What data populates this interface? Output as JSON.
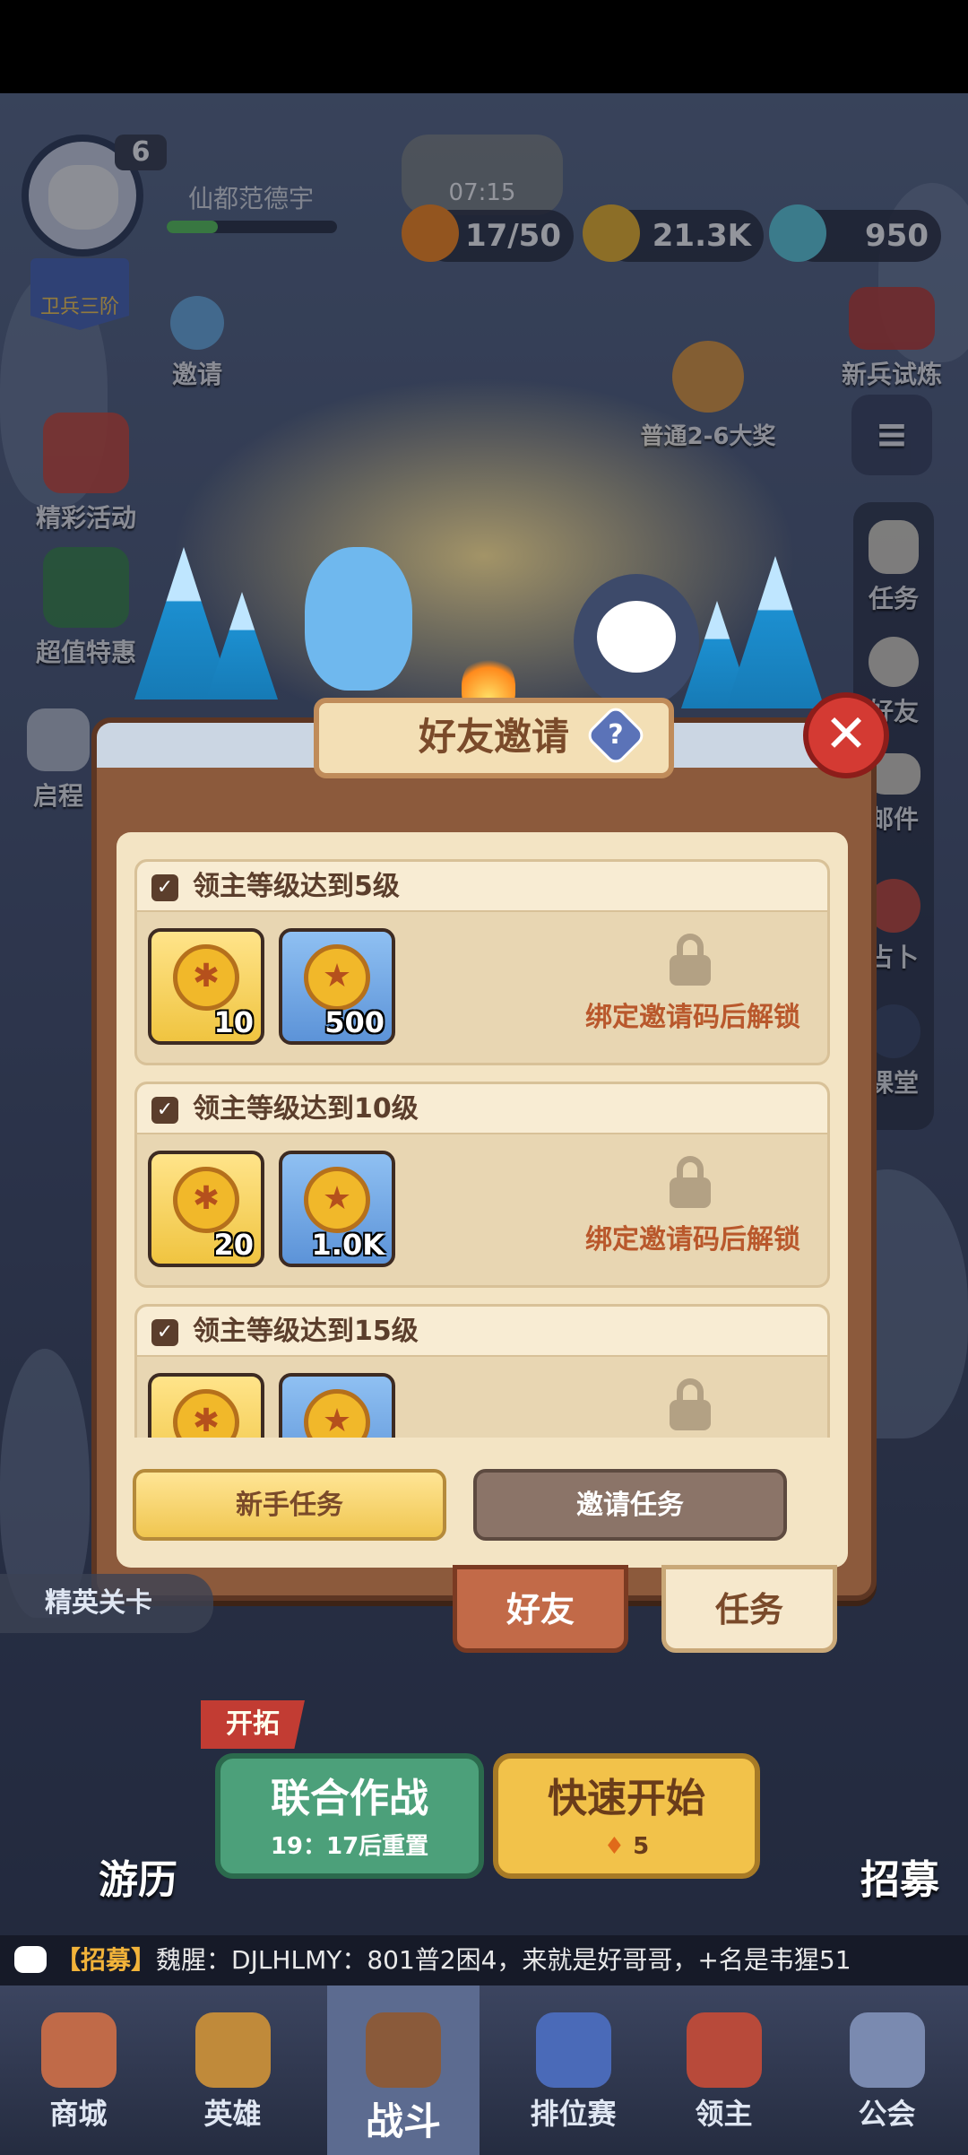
{
  "player": {
    "name": "仙都范德宇",
    "level": "6",
    "rank": "卫兵三阶"
  },
  "timer": "07:15",
  "resources": [
    {
      "name": "stamina",
      "value": "17/50",
      "color": "#ff8a1c"
    },
    {
      "name": "gold",
      "value": "21.3K",
      "color": "#f2b82a"
    },
    {
      "name": "gems",
      "value": "950",
      "color": "#5fd0e0"
    }
  ],
  "left_menu": {
    "invite": "邀请",
    "events": "精彩活动",
    "deals": "超值特惠",
    "journey": "启程"
  },
  "right_menu": {
    "trial": "新兵试炼",
    "prize": "普通2-6大奖",
    "task": "任务",
    "friend": "好友",
    "mail": "邮件",
    "divine": "占卜",
    "class": "课堂"
  },
  "dialog": {
    "title": "好友邀请",
    "help": "?",
    "close": "✕",
    "tasks": [
      {
        "title": "领主等级达到5级",
        "rewards": [
          {
            "type": "key",
            "count": "10"
          },
          {
            "type": "coin",
            "count": "500"
          }
        ],
        "status": "绑定邀请码后解锁"
      },
      {
        "title": "领主等级达到10级",
        "rewards": [
          {
            "type": "key",
            "count": "20"
          },
          {
            "type": "coin",
            "count": "1.0K"
          }
        ],
        "status": "绑定邀请码后解锁"
      },
      {
        "title": "领主等级达到15级",
        "rewards": [
          {
            "type": "key",
            "count": ""
          },
          {
            "type": "coin",
            "count": ""
          }
        ],
        "status": ""
      }
    ],
    "buttons": {
      "novice": "新手任务",
      "invite": "邀请任务"
    },
    "tabs": {
      "friends": "好友",
      "tasks": "任务"
    }
  },
  "lower": {
    "elite": "精英关卡",
    "expand": "开拓",
    "coop": {
      "title": "联合作战",
      "sub": "19：17后重置"
    },
    "quick": {
      "title": "快速开始",
      "cost": "5"
    },
    "travel": "游历",
    "recruit": "招募"
  },
  "chat": {
    "tag": "【招募】",
    "text": "魏腥：DJLHLMY：801普2困4，来就是好哥哥，+名是韦猩51"
  },
  "nav": {
    "shop": "商城",
    "hero": "英雄",
    "battle": "战斗",
    "rank": "排位赛",
    "lord": "领主",
    "guild": "公会"
  },
  "colors": {
    "accent": "#f2c24a",
    "panel": "#8c5a3c",
    "warning_text": "#b9582c",
    "close": "#d43a33"
  }
}
